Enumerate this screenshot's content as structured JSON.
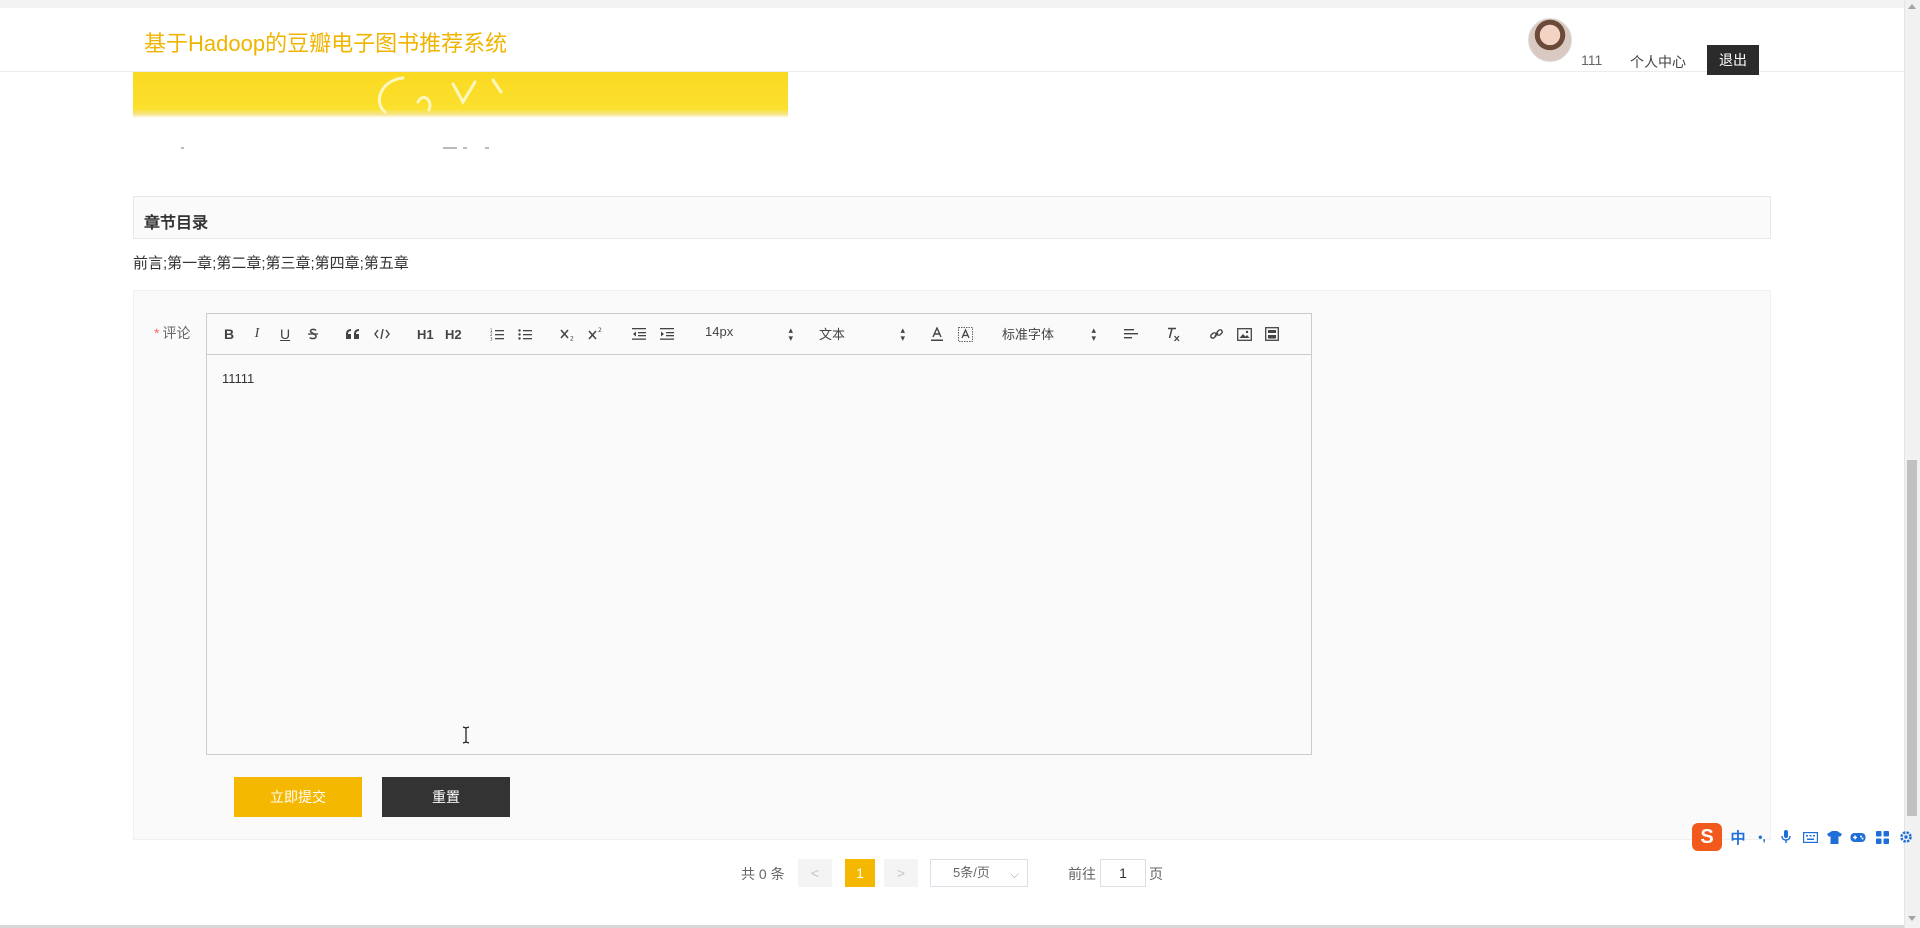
{
  "header": {
    "site_title": "基于Hadoop的豆瓣电子图书推荐系统",
    "username": "111",
    "user_center": "个人中心",
    "logout": "退出"
  },
  "chapter": {
    "title": "章节目录",
    "content": "前言;第一章;第二章;第三章;第四章;第五章"
  },
  "comment_form": {
    "label": "评论",
    "required_mark": "*",
    "editor_value": "11111",
    "toolbar": {
      "bold": "B",
      "italic": "I",
      "underline": "U",
      "header1": "H1",
      "header2": "H2",
      "font_size": "14px",
      "paragraph": "文本",
      "font_family": "标准字体"
    },
    "submit_label": "立即提交",
    "reset_label": "重置"
  },
  "pagination": {
    "total": "共 0 条",
    "prev": "<",
    "current_page": "1",
    "next": ">",
    "page_size": "5条/页",
    "goto_label": "前往",
    "goto_value": "1",
    "page_suffix": "页"
  },
  "ime": {
    "logo": "S",
    "mode": "中",
    "punct": "•,",
    "icons": [
      "microphone-icon",
      "keyboard-icon",
      "shirt-icon",
      "gamepad-icon",
      "apps-icon",
      "settings-icon"
    ]
  },
  "colors": {
    "accent": "#f5b800",
    "title_color": "#f0b400",
    "dark_button": "#333333",
    "ime_brand": "#f25a1d"
  }
}
